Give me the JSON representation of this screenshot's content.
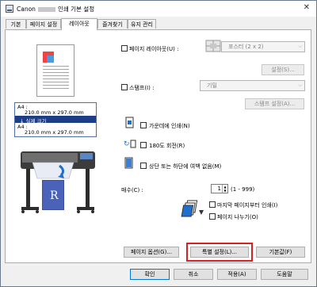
{
  "window": {
    "title_prefix": "Canon",
    "title_suffix": "인쇄 기본 설정",
    "close_glyph": "✕"
  },
  "tabs": [
    {
      "label": "기본"
    },
    {
      "label": "페이지 설정"
    },
    {
      "label": "레이아웃"
    },
    {
      "label": "즐겨찾기"
    },
    {
      "label": "유지 관리"
    }
  ],
  "active_tab": "레이아웃",
  "preview": {
    "size_label_1": "A4 :",
    "size_value_1": "210.0 mm x 297.0 mm",
    "arrow_label": "↓ 실제 크기",
    "size_label_2": "A4 :",
    "size_value_2": "210.0 mm x 297.0 mm"
  },
  "layout": {
    "page_layout_label": "페이지 레이아웃(U) :",
    "page_layout_value": "포스터 (2 x 2)",
    "settings_button": "설정(S)...",
    "stamp_label": "스탬프(I) :",
    "stamp_value": "기밀",
    "stamp_settings_button": "스탬프 설정(A)...",
    "center_print": "가운데에 인쇄(N)",
    "rotate_180": "180도 회전(R)",
    "no_margin": "상단 또는 하단에 여백 없음(M)"
  },
  "copies": {
    "label": "매수(C) :",
    "value": "1",
    "range": "(1 - 999)",
    "last_page_first": "마지막 페이지부터 인쇄(I)",
    "collate": "페이지 나누기(O)"
  },
  "buttons": {
    "page_options": "페이지 옵션(G)...",
    "special_settings": "특별 설정(L)...",
    "defaults": "기본값(F)",
    "ok": "확인",
    "cancel": "취소",
    "apply": "적용(A)",
    "help": "도움말"
  },
  "colors": {
    "highlight": "#1d3d86",
    "red_frame": "#d42121",
    "focus_blue": "#0078d7"
  }
}
